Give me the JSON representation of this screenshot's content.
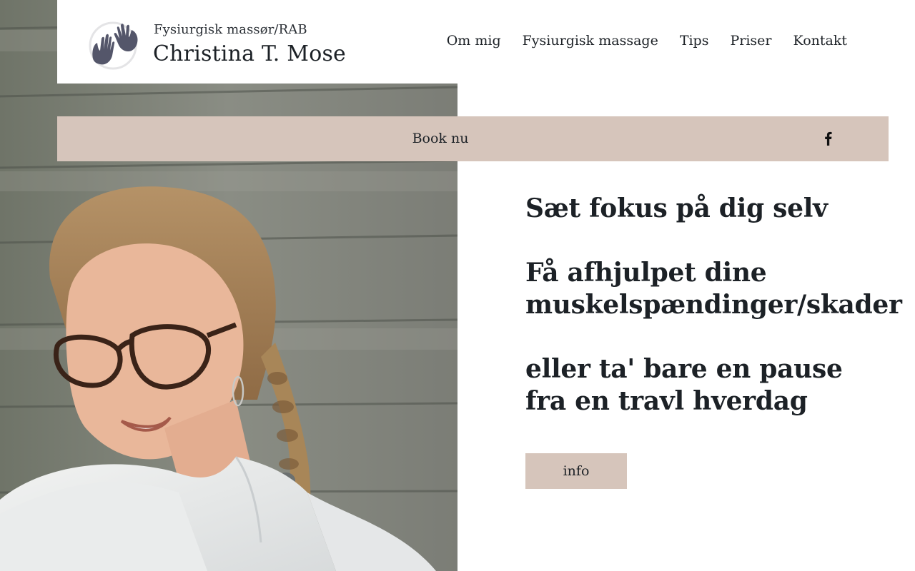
{
  "brand": {
    "subtitle": "Fysiurgisk massør/RAB",
    "name": "Christina T. Mose",
    "logo_icon": "hands-logo-icon"
  },
  "nav": {
    "items": [
      {
        "label": "Om mig"
      },
      {
        "label": "Fysiurgisk massage"
      },
      {
        "label": "Tips"
      },
      {
        "label": "Priser"
      },
      {
        "label": "Kontakt"
      }
    ]
  },
  "book_bar": {
    "label": "Book nu",
    "social_icon": "facebook-icon"
  },
  "hero": {
    "line1": "Sæt fokus på dig selv",
    "line2": "Få afhjulpet dine",
    "line3": "muskelspændinger/skader",
    "line4": "eller ta' bare en pause",
    "line5": "fra en travl hverdag",
    "button_label": "info"
  },
  "colors": {
    "accent": "#d6c5bb",
    "text": "#1c2126",
    "background": "#ffffff"
  }
}
